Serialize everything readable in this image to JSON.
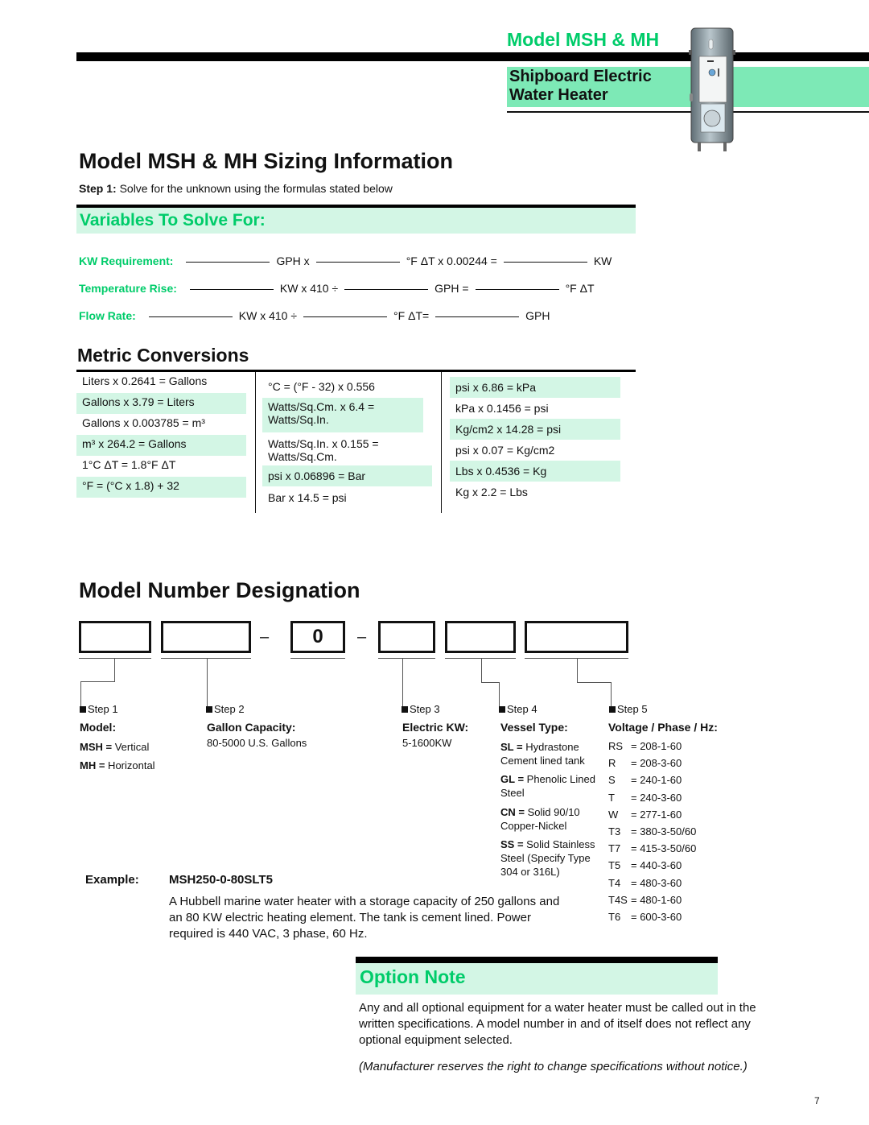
{
  "header": {
    "product_line": "Model MSH & MH",
    "subtitle_line1": "Shipboard Electric",
    "subtitle_line2": "Water Heater",
    "image_icon": "water-heater-illustration"
  },
  "sizing": {
    "title": "Model MSH & MH Sizing Information",
    "step_label": "Step 1:",
    "step_text": " Solve for the unknown using the formulas stated below",
    "variables_title": "Variables To Solve For:",
    "formulas": {
      "kw": {
        "label": "KW Requirement:",
        "t1": "GPH x",
        "t2": "°F ΔT x 0.00244 =",
        "t3": "KW"
      },
      "temp_rise": {
        "label": "Temperature Rise:",
        "t1": "KW x 410 ÷",
        "t2": "GPH =",
        "t3": "°F ΔT"
      },
      "flow_rate": {
        "label": "Flow Rate:",
        "t1": "KW x 410 ÷",
        "t2": "°F ΔT=",
        "t3": "GPH"
      }
    }
  },
  "metric": {
    "title": "Metric Conversions",
    "col1": [
      "Liters x 0.2641 = Gallons",
      "Gallons x 3.79 = Liters",
      "Gallons x 0.003785 = m³",
      "m³ x 264.2 = Gallons",
      "1°C ΔT  =  1.8°F ΔT",
      "°F = (°C  x  1.8)  +  32"
    ],
    "col2": [
      "°C  =  (°F  -  32)  x  0.556",
      "Watts/Sq.Cm. x 6.4 = Watts/Sq.In.",
      "Watts/Sq.In. x 0.155 = Watts/Sq.Cm.",
      "psi x 0.06896 = Bar",
      "Bar x 14.5 = psi"
    ],
    "col3": [
      "psi x 6.86 = kPa",
      "kPa x 0.1456 = psi",
      "Kg/cm2 x 14.28 = psi",
      "psi x 0.07 = Kg/cm2",
      "Lbs x 0.4536 = Kg",
      "Kg x 2.2 = Lbs"
    ]
  },
  "model_number": {
    "title": "Model Number Designation",
    "fixed_digit": "0",
    "dash": "–",
    "steps": [
      "Step 1",
      "Step 2",
      "Step 3",
      "Step 4",
      "Step 5"
    ],
    "model": {
      "heading": "Model:",
      "options": [
        {
          "code": "MSH",
          "desc": " Vertical"
        },
        {
          "code": "MH",
          "desc": " Horizontal"
        }
      ]
    },
    "capacity": {
      "heading": "Gallon Capacity:",
      "range": "80-5000 U.S. Gallons"
    },
    "electric": {
      "heading": "Electric KW:",
      "range": "5-1600KW"
    },
    "vessel": {
      "heading": "Vessel Type:",
      "options": [
        {
          "code": "SL",
          "desc1": " Hydrastone",
          "desc2": "Cement lined tank"
        },
        {
          "code": "GL",
          "desc1": " Phenolic Lined",
          "desc2": "Steel"
        },
        {
          "code": "CN",
          "desc1": " Solid 90/10",
          "desc2": "Copper-Nickel"
        },
        {
          "code": "SS",
          "desc1": " Solid Stainless",
          "desc2": "Steel (Specify Type",
          "desc3": "304 or 316L)"
        }
      ]
    },
    "voltage": {
      "heading": "Voltage / Phase / Hz:",
      "options": [
        {
          "code": "RS",
          "value": "=  208-1-60"
        },
        {
          "code": "R",
          "value": "=  208-3-60"
        },
        {
          "code": "S",
          "value": "=  240-1-60"
        },
        {
          "code": "T",
          "value": "=  240-3-60"
        },
        {
          "code": "W",
          "value": "=  277-1-60"
        },
        {
          "code": "T3",
          "value": "=  380-3-50/60"
        },
        {
          "code": "T7",
          "value": "=  415-3-50/60"
        },
        {
          "code": "T5",
          "value": "=  440-3-60"
        },
        {
          "code": "T4",
          "value": "=  480-3-60"
        },
        {
          "code": "T4S",
          "value": "= 480-1-60"
        },
        {
          "code": "T6",
          "value": "=  600-3-60"
        }
      ]
    },
    "example_label": "Example:",
    "example_model": "MSH250-0-80SLT5",
    "example_desc": "A Hubbell marine water heater with a storage capacity of 250 gallons and an 80 KW electric heating element. The tank is cement lined. Power required is 440 VAC, 3 phase, 60 Hz."
  },
  "option_note": {
    "title": "Option Note",
    "text": "Any and all optional equipment for a water heater must be called out in the written specifications. A model number in and of itself does not reflect any optional equipment selected.",
    "disclaimer": "(Manufacturer reserves the right to change specifications without notice.)"
  },
  "page_number": "7"
}
